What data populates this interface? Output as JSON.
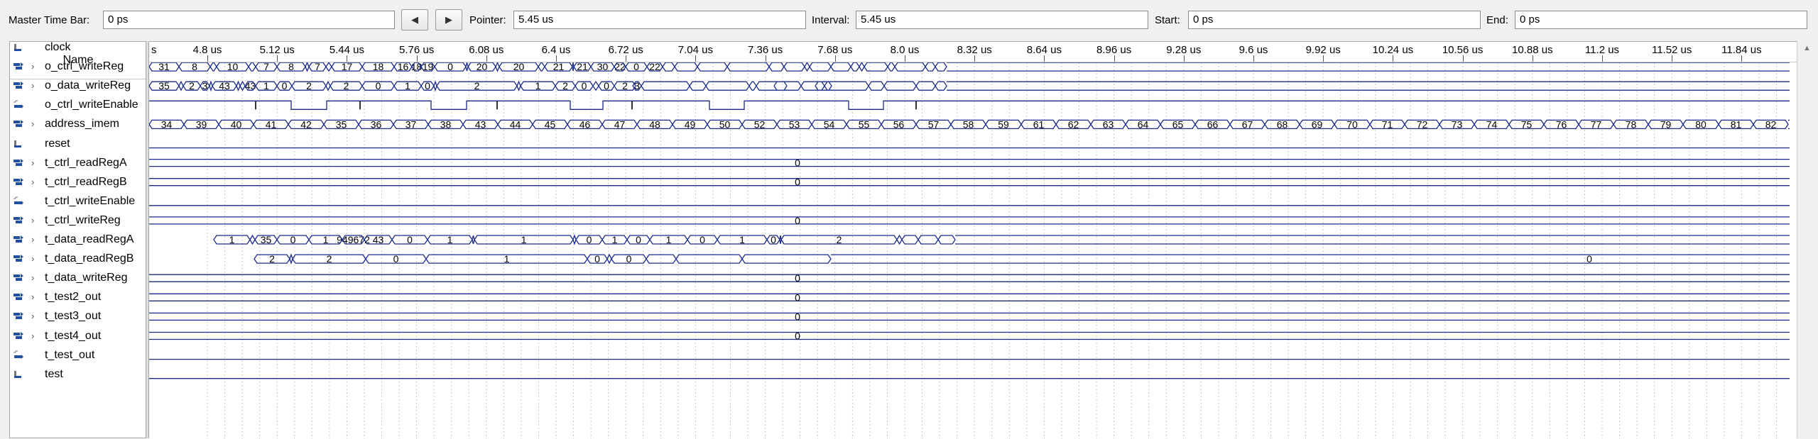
{
  "toolbar": {
    "master_label": "Master Time Bar:",
    "master_value": "0 ps",
    "prev_icon": "arrow-left-icon",
    "next_icon": "arrow-right-icon",
    "pointer_label": "Pointer:",
    "pointer_value": "5.45 us",
    "interval_label": "Interval:",
    "interval_value": "5.45 us",
    "start_label": "Start:",
    "start_value": "0 ps",
    "end_label": "End:",
    "end_value": "0 ps"
  },
  "names_header": "Name",
  "ruler": {
    "first_tick": "s",
    "ticks": [
      "4.8 us",
      "5.12 us",
      "5.44 us",
      "5.76 us",
      "6.08 us",
      "6.4 us",
      "6.72 us",
      "7.04 us",
      "7.36 us",
      "7.68 us",
      "8.0 us",
      "8.32 us",
      "8.64 us",
      "8.96 us",
      "9.28 us",
      "9.6 us",
      "9.92 us",
      "10.24 us",
      "10.56 us",
      "10.88 us",
      "11.2 us",
      "11.52 us",
      "11.84 us"
    ]
  },
  "signals": [
    {
      "name": "clock",
      "icon": "input-pin-icon",
      "expandable": false
    },
    {
      "name": "o_ctrl_writeReg",
      "icon": "output-bus-icon",
      "expandable": true
    },
    {
      "name": "o_data_writeReg",
      "icon": "output-bus-icon",
      "expandable": true
    },
    {
      "name": "o_ctrl_writeEnable",
      "icon": "output-pin-icon",
      "expandable": false
    },
    {
      "name": "address_imem",
      "icon": "input-bus-icon",
      "expandable": true
    },
    {
      "name": "reset",
      "icon": "input-pin-icon",
      "expandable": false
    },
    {
      "name": "t_ctrl_readRegA",
      "icon": "output-bus-icon",
      "expandable": true
    },
    {
      "name": "t_ctrl_readRegB",
      "icon": "output-bus-icon",
      "expandable": true
    },
    {
      "name": "t_ctrl_writeEnable",
      "icon": "output-pin-icon",
      "expandable": false
    },
    {
      "name": "t_ctrl_writeReg",
      "icon": "output-bus-icon",
      "expandable": true
    },
    {
      "name": "t_data_readRegA",
      "icon": "output-bus-icon",
      "expandable": true
    },
    {
      "name": "t_data_readRegB",
      "icon": "output-bus-icon",
      "expandable": true
    },
    {
      "name": "t_data_writeReg",
      "icon": "output-bus-icon",
      "expandable": true
    },
    {
      "name": "t_test2_out",
      "icon": "output-bus-icon",
      "expandable": true
    },
    {
      "name": "t_test3_out",
      "icon": "output-bus-icon",
      "expandable": true
    },
    {
      "name": "t_test4_out",
      "icon": "output-bus-icon",
      "expandable": true
    },
    {
      "name": "t_test_out",
      "icon": "output-pin-icon",
      "expandable": false
    },
    {
      "name": "test",
      "icon": "input-pin-icon",
      "expandable": false
    }
  ],
  "waves": {
    "o_ctrl_writeReg": [
      "31",
      "8",
      "9",
      "10",
      "31",
      "7",
      "8",
      "10",
      "7",
      "16",
      "17",
      "18",
      "16",
      "18",
      "19",
      "0",
      "19",
      "20",
      "16",
      "20",
      "30",
      "21",
      "0",
      "21",
      "30",
      "22",
      "0",
      "22"
    ],
    "o_data_writeReg": [
      "35",
      "1",
      "2",
      "3",
      "35",
      "43",
      "-1",
      "1",
      "43",
      "1",
      "0",
      "2",
      "1",
      "2",
      "0",
      "1",
      "0",
      "1",
      "2",
      "1",
      "1",
      "2",
      "0",
      "1",
      "0",
      "2",
      "3"
    ],
    "address_imem": [
      "34",
      "39",
      "40",
      "41",
      "42",
      "35",
      "36",
      "37",
      "38",
      "43",
      "44",
      "45",
      "46",
      "47",
      "48",
      "49",
      "50",
      "52",
      "53",
      "54",
      "55",
      "56",
      "57",
      "58",
      "59",
      "61",
      "62",
      "63",
      "64",
      "65",
      "66",
      "67",
      "68",
      "69",
      "70",
      "71",
      "72",
      "73",
      "74",
      "75",
      "76",
      "77",
      "78",
      "79",
      "80",
      "81",
      "82"
    ],
    "t_ctrl_readRegA": "0",
    "t_ctrl_readRegB": "0",
    "t_ctrl_writeReg": "0",
    "t_data_readRegA": [
      "1",
      "1",
      "35",
      "0",
      "1",
      "949672",
      "43",
      "0",
      "1",
      "0",
      "1",
      "0",
      "0",
      "1",
      "0",
      "1",
      "0",
      "1",
      "0",
      "1",
      "2"
    ],
    "t_data_readRegB": [
      "2",
      "0",
      "2",
      "0",
      "1",
      "0",
      "1",
      "0"
    ],
    "t_data_writeReg": "0",
    "t_test2_out": "0",
    "t_test3_out": "0",
    "t_test4_out": "0"
  },
  "colors": {
    "wave": "#1a2a8a",
    "grid": "#c8c8c8",
    "panel_bg": "#ffffff",
    "window_bg": "#f0f0f0"
  }
}
